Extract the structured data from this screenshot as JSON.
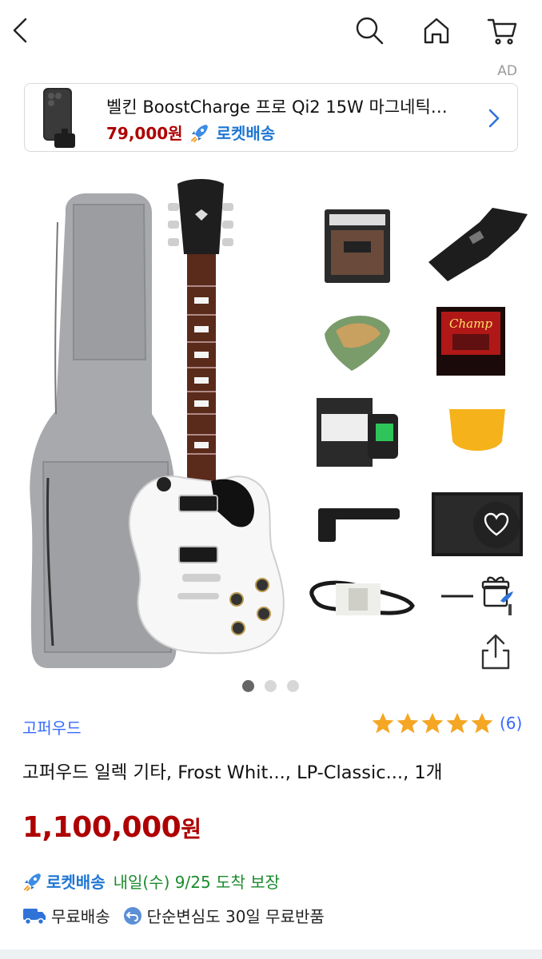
{
  "header": {
    "icons": [
      "back-arrow-icon",
      "search-icon",
      "home-icon",
      "cart-icon"
    ]
  },
  "ad": {
    "label": "AD",
    "title": "벨킨 BoostCharge 프로 Qi2 15W 마그네틱…",
    "price": "79,000원",
    "rocket_label": "로켓배송"
  },
  "gallery": {
    "page_count": 3,
    "active_page": 1
  },
  "product": {
    "brand": "고퍼우드",
    "rating_stars": 5,
    "review_count": "(6)",
    "title": "고퍼우드 일렉 기타, Frost Whit..., LP-Classic..., 1개",
    "price_number": "1,100,000",
    "price_unit": "원"
  },
  "delivery": {
    "rocket_label": "로켓배송",
    "date_text": "내일(수) 9/25 도착 보장"
  },
  "benefits": {
    "free_shipping": "무료배송",
    "free_return": "단순변심도 30일 무료반품"
  },
  "colors": {
    "price_red": "#ae0000",
    "link_blue": "#346aff",
    "rocket_blue": "#1f76d2",
    "arrival_green": "#1a8b2c",
    "star_orange": "#f5a623"
  }
}
